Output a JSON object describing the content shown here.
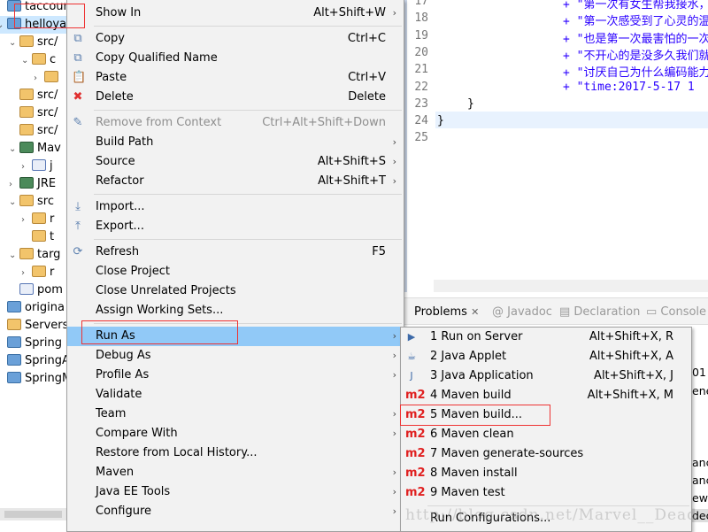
{
  "tree": {
    "items": [
      {
        "label": "taccoun",
        "indent": 0,
        "arrow": "",
        "icon": "project"
      },
      {
        "label": "helloya",
        "indent": 0,
        "arrow": "⌄",
        "icon": "maven-project",
        "selected": true
      },
      {
        "label": "src/",
        "indent": 1,
        "arrow": "⌄",
        "icon": "source-folder"
      },
      {
        "label": "c",
        "indent": 2,
        "arrow": "⌄",
        "icon": "package"
      },
      {
        "label": "",
        "indent": 3,
        "arrow": "›",
        "icon": "file"
      },
      {
        "label": "src/",
        "indent": 1,
        "arrow": "",
        "icon": "source-folder"
      },
      {
        "label": "src/",
        "indent": 1,
        "arrow": "",
        "icon": "source-folder"
      },
      {
        "label": "src/",
        "indent": 1,
        "arrow": "",
        "icon": "source-folder"
      },
      {
        "label": "Mav",
        "indent": 1,
        "arrow": "⌄",
        "icon": "library"
      },
      {
        "label": "j",
        "indent": 2,
        "arrow": "›",
        "icon": "jar"
      },
      {
        "label": "JRE",
        "indent": 1,
        "arrow": "›",
        "icon": "library"
      },
      {
        "label": "src",
        "indent": 1,
        "arrow": "⌄",
        "icon": "folder"
      },
      {
        "label": "r",
        "indent": 2,
        "arrow": "›",
        "icon": "folder"
      },
      {
        "label": "t",
        "indent": 2,
        "arrow": "",
        "icon": "folder"
      },
      {
        "label": "targ",
        "indent": 1,
        "arrow": "⌄",
        "icon": "folder"
      },
      {
        "label": "r",
        "indent": 2,
        "arrow": "›",
        "icon": "folder"
      },
      {
        "label": "pom",
        "indent": 1,
        "arrow": "",
        "icon": "pom-file"
      },
      {
        "label": "origina",
        "indent": 0,
        "arrow": "",
        "icon": "project"
      },
      {
        "label": "Servers",
        "indent": 0,
        "arrow": "",
        "icon": "folder"
      },
      {
        "label": "Spring",
        "indent": 0,
        "arrow": "",
        "icon": "project"
      },
      {
        "label": "SpringA",
        "indent": 0,
        "arrow": "",
        "icon": "project"
      },
      {
        "label": "SpringM",
        "indent": 0,
        "arrow": "",
        "icon": "project"
      }
    ]
  },
  "editor": {
    "lines": [
      {
        "n": "17",
        "code": "+ \"第一次有女生帮我接水，第"
      },
      {
        "n": "18",
        "code": "+ \"第一次感受到了心灵的温暖"
      },
      {
        "n": "19",
        "code": "+ \"也是第一次最害怕的一次。"
      },
      {
        "n": "20",
        "code": "+ \"不开心的是没多久我们就要"
      },
      {
        "n": "21",
        "code": "+ \"讨厌自己为什么编码能力那"
      },
      {
        "n": "22",
        "code": "+ \"time:2017-5-17 1"
      },
      {
        "n": "23",
        "code": "}"
      },
      {
        "n": "24",
        "code": "}"
      },
      {
        "n": "25",
        "code": ""
      }
    ]
  },
  "bottom": {
    "tabs": [
      "Problems",
      "Javadoc",
      "Declaration",
      "Console"
    ],
    "fragments": [
      "01",
      "ene",
      "anc",
      "anc",
      "ew.",
      "dec"
    ]
  },
  "menu": {
    "groups": [
      [
        {
          "label": "Show In",
          "shortcut": "Alt+Shift+W",
          "submenu": true
        }
      ],
      [
        {
          "label": "Copy",
          "shortcut": "Ctrl+C",
          "icon": "copy-icon"
        },
        {
          "label": "Copy Qualified Name",
          "icon": "copy-qualified-icon"
        },
        {
          "label": "Paste",
          "shortcut": "Ctrl+V",
          "icon": "paste-icon"
        },
        {
          "label": "Delete",
          "shortcut": "Delete",
          "icon": "delete-icon"
        }
      ],
      [
        {
          "label": "Remove from Context",
          "shortcut": "Ctrl+Alt+Shift+Down",
          "disabled": true,
          "icon": "remove-context-icon"
        },
        {
          "label": "Build Path",
          "submenu": true
        },
        {
          "label": "Source",
          "shortcut": "Alt+Shift+S",
          "submenu": true
        },
        {
          "label": "Refactor",
          "shortcut": "Alt+Shift+T",
          "submenu": true
        }
      ],
      [
        {
          "label": "Import...",
          "icon": "import-icon"
        },
        {
          "label": "Export...",
          "icon": "export-icon"
        }
      ],
      [
        {
          "label": "Refresh",
          "shortcut": "F5",
          "icon": "refresh-icon"
        },
        {
          "label": "Close Project"
        },
        {
          "label": "Close Unrelated Projects"
        },
        {
          "label": "Assign Working Sets..."
        }
      ],
      [
        {
          "label": "Run As",
          "submenu": true,
          "highlighted": true
        },
        {
          "label": "Debug As",
          "submenu": true
        },
        {
          "label": "Profile As",
          "submenu": true
        },
        {
          "label": "Validate"
        },
        {
          "label": "Team",
          "submenu": true
        },
        {
          "label": "Compare With",
          "submenu": true
        },
        {
          "label": "Restore from Local History..."
        },
        {
          "label": "Maven",
          "submenu": true
        },
        {
          "label": "Java EE Tools",
          "submenu": true
        },
        {
          "label": "Configure",
          "submenu": true
        }
      ]
    ]
  },
  "submenu": {
    "items": [
      {
        "label": "1 Run on Server",
        "shortcut": "Alt+Shift+X, R",
        "icon": "run-server-icon"
      },
      {
        "label": "2 Java Applet",
        "shortcut": "Alt+Shift+X, A",
        "icon": "java-applet-icon"
      },
      {
        "label": "3 Java Application",
        "shortcut": "Alt+Shift+X, J",
        "icon": "java-app-icon"
      },
      {
        "label": "4 Maven build",
        "shortcut": "Alt+Shift+X, M",
        "icon": "m2"
      },
      {
        "label": "5 Maven build...",
        "icon": "m2",
        "boxed": true
      },
      {
        "label": "6 Maven clean",
        "icon": "m2"
      },
      {
        "label": "7 Maven generate-sources",
        "icon": "m2"
      },
      {
        "label": "8 Maven install",
        "icon": "m2"
      },
      {
        "label": "9 Maven test",
        "icon": "m2"
      }
    ],
    "footer": "Run Configurations...",
    "m2_label": "m2"
  },
  "watermark": "http://blog.csdn.net/Marvel__Dead",
  "colors": {
    "highlight": "#91c9f7",
    "annotation": "#ee3333",
    "string": "#2a00ff"
  }
}
